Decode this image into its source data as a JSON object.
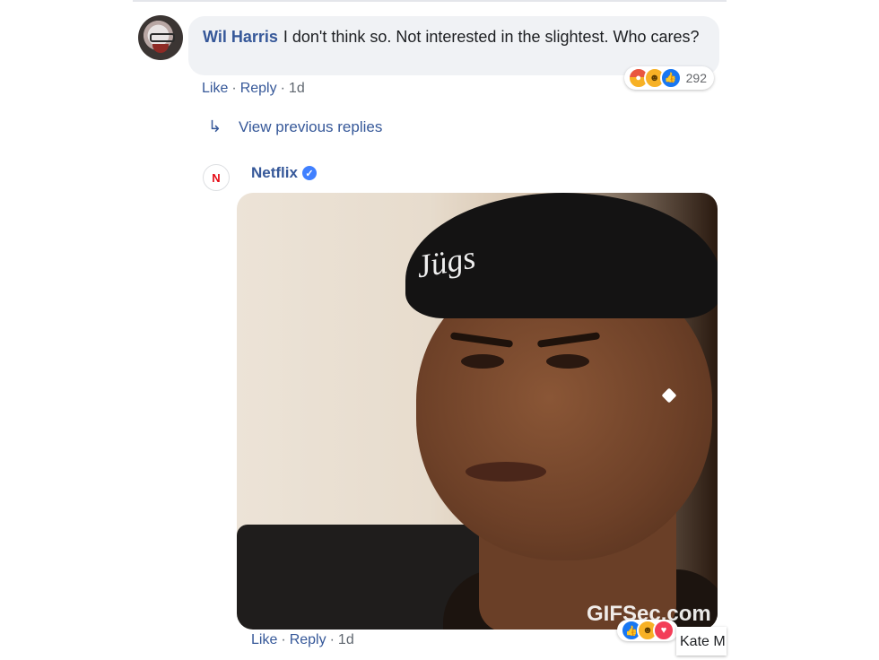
{
  "comment": {
    "author": "Wil Harris",
    "text": "I don't think so. Not interested in the slightest. Who cares?",
    "reaction_icons": [
      "angry-icon",
      "haha-icon",
      "like-icon"
    ],
    "reaction_count": "292",
    "actions": {
      "like": "Like",
      "reply": "Reply",
      "separator": "·",
      "time": "1d"
    }
  },
  "replies": {
    "view_previous": "View previous replies",
    "arrow_icon": "reply-arrow-icon"
  },
  "reply": {
    "author": "Netflix",
    "avatar_letter": "N",
    "verified_icon": "verified-badge-icon",
    "gif": {
      "beanie_text": "Jügs",
      "watermark": "GIFSec.com"
    },
    "reaction_icons": [
      "like-icon",
      "haha-icon",
      "love-icon"
    ],
    "actions": {
      "like": "Like",
      "reply": "Reply",
      "separator": "·",
      "time": "1d"
    }
  },
  "chat_chip": {
    "name": "Kate M"
  },
  "colors": {
    "link": "#365899",
    "bubble": "#f0f2f5",
    "netflix_red": "#e50914",
    "verified": "#4080ff"
  }
}
